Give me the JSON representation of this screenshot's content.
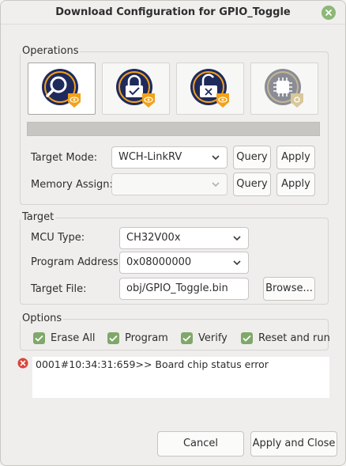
{
  "window": {
    "title": "Download Configuration for GPIO_Toggle"
  },
  "operations": {
    "group_label": "Operations",
    "tiles": [
      {
        "name": "query-chip-icon",
        "active": true
      },
      {
        "name": "lock-chip-icon",
        "active": false
      },
      {
        "name": "unlock-chip-icon",
        "active": false
      },
      {
        "name": "chip-protect-icon",
        "active": false
      }
    ],
    "progress": 0,
    "target_mode": {
      "label": "Target Mode:",
      "value": "WCH-LinkRV"
    },
    "memory_assign": {
      "label": "Memory Assign:",
      "value": ""
    },
    "query_label": "Query",
    "apply_label": "Apply"
  },
  "target": {
    "group_label": "Target",
    "mcu_type": {
      "label": "MCU Type:",
      "value": "CH32V00x"
    },
    "program_address": {
      "label": "Program Address:",
      "value": "0x08000000"
    },
    "target_file": {
      "label": "Target File:",
      "value": "obj/GPIO_Toggle.bin"
    },
    "browse_label": "Browse..."
  },
  "options": {
    "group_label": "Options",
    "erase_all": "Erase All",
    "program": "Program",
    "verify": "Verify",
    "reset_and_run": "Reset and run"
  },
  "log": {
    "line": "0001#10:34:31:659>> Board chip status error"
  },
  "footer": {
    "cancel_label": "Cancel",
    "apply_close_label": "Apply and Close"
  },
  "colors": {
    "accent_green": "#7fa86a",
    "icon_navy": "#1f2a5c",
    "badge_orange": "#f2a21b",
    "error_red": "#d9453a"
  }
}
